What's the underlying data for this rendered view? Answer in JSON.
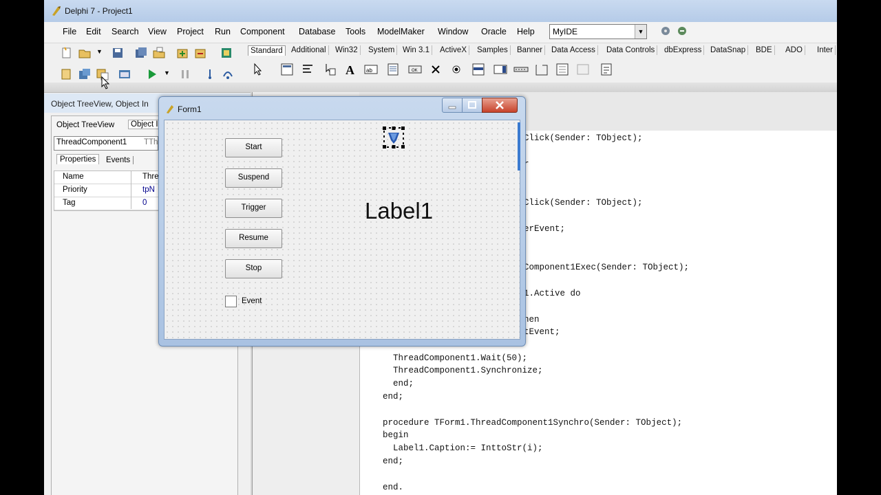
{
  "window": {
    "title": "Delphi 7 - Project1"
  },
  "menu": [
    "File",
    "Edit",
    "Search",
    "View",
    "Project",
    "Run",
    "Component",
    "Database",
    "Tools",
    "ModelMaker",
    "Window",
    "Oracle",
    "Help"
  ],
  "desktop_combo": {
    "value": "MyIDE"
  },
  "palette_tabs": [
    "Standard",
    "Additional",
    "Win32",
    "System",
    "Win 3.1",
    "ActiveX",
    "Samples",
    "Banner",
    "Data Access",
    "Data Controls",
    "dbExpress",
    "DataSnap",
    "BDE",
    "ADO",
    "Inter"
  ],
  "inspector": {
    "title": "Object TreeView, Object In",
    "tabs": [
      "Object TreeView",
      "Object I"
    ],
    "object_combo": "ThreadComponent1",
    "object_type": "TTh",
    "subtabs": [
      "Properties",
      "Events"
    ],
    "rows": [
      {
        "name": "Name",
        "value": "Thre"
      },
      {
        "name": "Priority",
        "value": "tpN"
      },
      {
        "name": "Tag",
        "value": "0"
      }
    ]
  },
  "form": {
    "title": "Form1",
    "buttons": [
      "Start",
      "Suspend",
      "Trigger",
      "Resume",
      "Stop"
    ],
    "checkbox_label": "Event",
    "checkbox_checked": false,
    "label": "Label1"
  },
  "code_lines": [
    "Click(Sender: TObject);",
    "r",
    "Click(Sender: TObject);",
    "erEvent;",
    "Component1Exec(Sender: TObject);",
    "1.Active do",
    "hen",
    "tEvent;",
    "  ThreadComponent1.Wait(50);",
    "  ThreadComponent1.Synchronize;",
    "  end;",
    "end;",
    "procedure TForm1.ThreadComponent1Synchro(Sender: TObject);",
    "begin",
    "  Label1.Caption:= InttoStr(i);",
    "end;",
    "end."
  ]
}
